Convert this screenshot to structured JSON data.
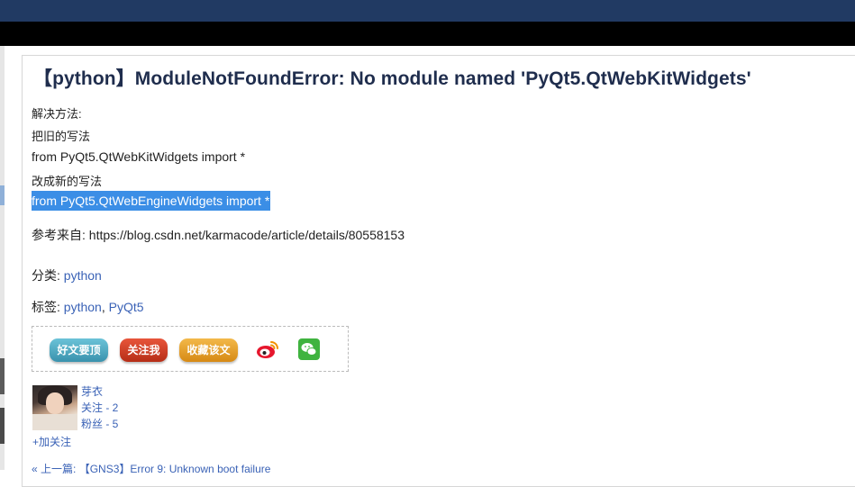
{
  "article": {
    "title": "【python】ModuleNotFoundError: No module named 'PyQt5.QtWebKitWidgets'",
    "lines": [
      "解决方法:",
      "把旧的写法",
      "from PyQt5.QtWebKitWidgets import *",
      "改成新的写法",
      "from PyQt5.QtWebEngineWidgets import *"
    ],
    "ref_label": "参考来自:",
    "ref_url": "https://blog.csdn.net/karmacode/article/details/80558153"
  },
  "category": {
    "label": "分类:",
    "value": "python"
  },
  "tags": {
    "label": "标签:",
    "items": [
      "python",
      "PyQt5"
    ],
    "separator": ", "
  },
  "share": {
    "digg_label": "好文要顶",
    "follow_label": "关注我",
    "fav_label": "收藏该文",
    "icons": [
      "weibo-icon",
      "wechat-icon"
    ]
  },
  "author": {
    "name": "芽衣",
    "follow_count_text": "关注 - 2",
    "fans_count_text": "粉丝 - 5",
    "add_follow_label": "+加关注"
  },
  "nav": {
    "prev_label": "« 上一篇:",
    "prev_link": "【GNS3】Error 9: Unknown boot failure"
  },
  "colors": {
    "top_bar": "#213a63",
    "link": "#3a62b6",
    "selection": "#3b8ee6",
    "title": "#1f2d4d"
  }
}
